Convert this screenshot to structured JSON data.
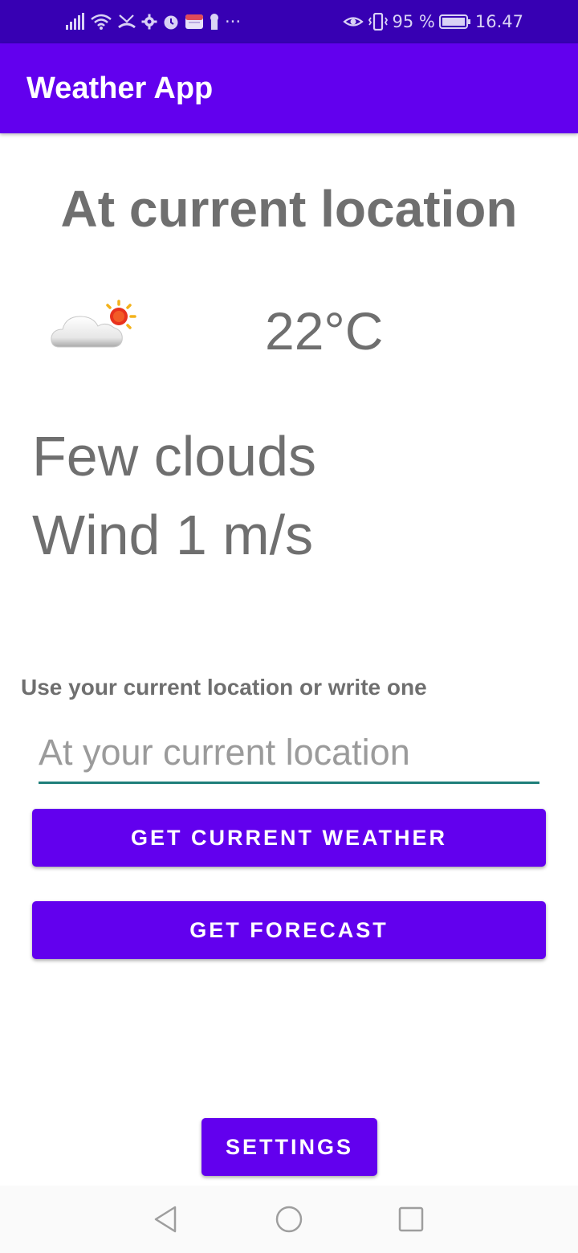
{
  "status_bar": {
    "battery_percent": "95 %",
    "time": "16.47",
    "more_indicator": "···",
    "icons_left": [
      "signal-icon",
      "wifi-icon",
      "missed-call-icon",
      "settings-gear-icon",
      "alarm-icon",
      "app-notification-icon",
      "keyhole-icon",
      "more-icon"
    ],
    "icons_right": [
      "eye-comfort-icon",
      "vibrate-icon",
      "battery-icon"
    ]
  },
  "app_bar": {
    "title": "Weather App",
    "color": "#6200ee"
  },
  "weather": {
    "heading": "At current location",
    "icon": "partly-cloudy-icon",
    "temperature": "22°C",
    "description": "Few clouds",
    "wind": "Wind 1 m/s"
  },
  "location": {
    "prompt": "Use your current location or write one",
    "placeholder": "At your current location",
    "value": ""
  },
  "buttons": {
    "current_weather": "GET CURRENT WEATHER",
    "forecast": "GET FORECAST",
    "settings": "SETTINGS"
  },
  "nav_bar": {
    "back": "back-icon",
    "home": "home-icon",
    "recents": "recents-icon"
  },
  "colors": {
    "primary": "#6200ee",
    "primary_dark": "#3700b3",
    "text_gray": "#6f6f6f",
    "input_underline": "#1e7f7a"
  }
}
